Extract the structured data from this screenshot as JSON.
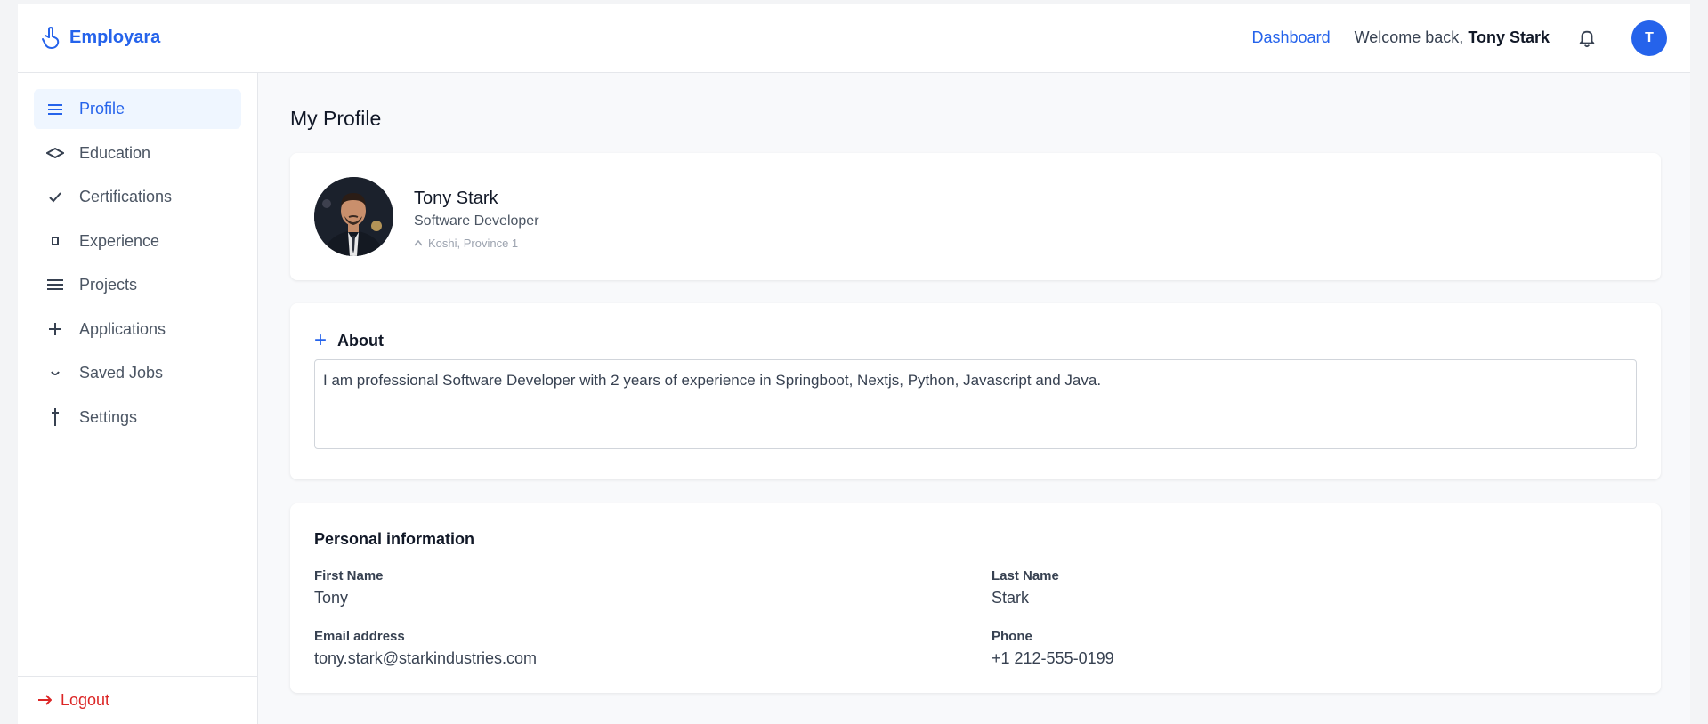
{
  "brand": {
    "name": "Employara"
  },
  "header": {
    "dashboard_label": "Dashboard",
    "welcome_prefix": "Welcome back,",
    "user_name": "Tony Stark",
    "avatar_initial": "T"
  },
  "sidebar": {
    "items": [
      {
        "label": "Profile",
        "icon": "menu-icon",
        "active": true
      },
      {
        "label": "Education",
        "icon": "graduation-icon",
        "active": false
      },
      {
        "label": "Certifications",
        "icon": "check-icon",
        "active": false
      },
      {
        "label": "Experience",
        "icon": "briefcase-icon",
        "active": false
      },
      {
        "label": "Projects",
        "icon": "list-icon",
        "active": false
      },
      {
        "label": "Applications",
        "icon": "plus-icon",
        "active": false
      },
      {
        "label": "Saved Jobs",
        "icon": "chevron-down-icon",
        "active": false
      },
      {
        "label": "Settings",
        "icon": "dagger-icon",
        "active": false
      }
    ],
    "logout_label": "Logout"
  },
  "main": {
    "page_title": "My Profile",
    "profile": {
      "name": "Tony Stark",
      "role": "Software Developer",
      "location": "Koshi, Province 1"
    },
    "about": {
      "title": "About",
      "text": "I am professional Software Developer with 2 years of experience in Springboot, Nextjs, Python, Javascript and Java."
    },
    "personal": {
      "title": "Personal information",
      "first_name_label": "First Name",
      "first_name": "Tony",
      "last_name_label": "Last Name",
      "last_name": "Stark",
      "email_label": "Email address",
      "email": "tony.stark@starkindustries.com",
      "phone_label": "Phone",
      "phone": "+1 212-555-0199"
    }
  },
  "colors": {
    "accent": "#2563eb",
    "danger": "#dc2626",
    "active_bg": "#eff6ff"
  }
}
